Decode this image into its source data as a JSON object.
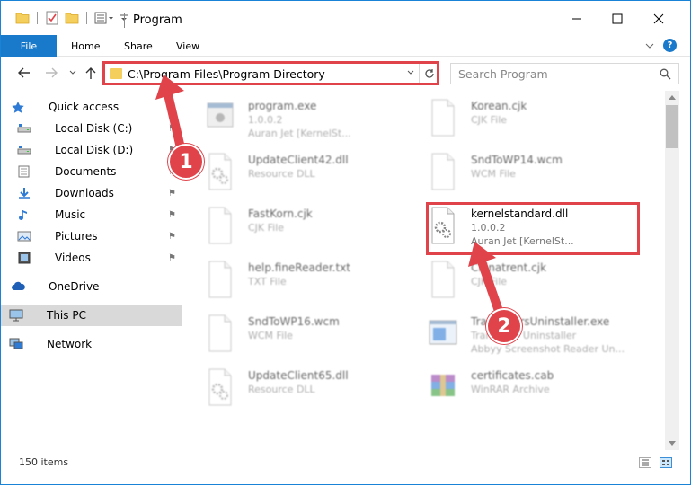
{
  "window": {
    "title": "Program",
    "minimize": "—",
    "maximize": "☐",
    "close": "✕"
  },
  "ribbon": {
    "tabs": [
      {
        "label": "File"
      },
      {
        "label": "Home"
      },
      {
        "label": "Share"
      },
      {
        "label": "View"
      }
    ],
    "help": "?"
  },
  "address": {
    "path": "C:\\Program Files\\Program Directory",
    "search_placeholder": "Search Program"
  },
  "nav": {
    "items": [
      {
        "label": "Quick access",
        "icon": "star-icon",
        "pinned": false
      },
      {
        "label": "Local Disk (C:)",
        "icon": "drive-icon",
        "pinned": true
      },
      {
        "label": "Local Disk (D:)",
        "icon": "drive-icon",
        "pinned": true
      },
      {
        "label": "Documents",
        "icon": "documents-icon",
        "pinned": true
      },
      {
        "label": "Downloads",
        "icon": "download-icon",
        "pinned": true
      },
      {
        "label": "Music",
        "icon": "music-icon",
        "pinned": true
      },
      {
        "label": "Pictures",
        "icon": "pictures-icon",
        "pinned": true
      },
      {
        "label": "Videos",
        "icon": "videos-icon",
        "pinned": true
      },
      {
        "label": "OneDrive",
        "icon": "cloud-icon",
        "pinned": false
      },
      {
        "label": "This PC",
        "icon": "computer-icon",
        "pinned": false
      },
      {
        "label": "Network",
        "icon": "network-icon",
        "pinned": false
      }
    ],
    "pin_glyph": "⚑"
  },
  "files": [
    {
      "name": "program.exe",
      "line2": "1.0.0.2",
      "line3": "Auran Jet [KernelSt...",
      "icon": "exe-icon"
    },
    {
      "name": "Korean.cjk",
      "line2": "CJK File",
      "line3": "",
      "icon": "file-icon"
    },
    {
      "name": "UpdateClient42.dll",
      "line2": "Resource DLL",
      "line3": "",
      "icon": "dll-icon"
    },
    {
      "name": "SndToWP14.wcm",
      "line2": "WCM File",
      "line3": "",
      "icon": "file-icon"
    },
    {
      "name": "FastKorn.cjk",
      "line2": "CJK File",
      "line3": "",
      "icon": "file-icon"
    },
    {
      "name": "kernelstandard.dll",
      "line2": "1.0.0.2",
      "line3": "Auran Jet [KernelSt...",
      "icon": "dll-icon"
    },
    {
      "name": "help.fineReader.txt",
      "line2": "TXT File",
      "line3": "",
      "icon": "file-icon"
    },
    {
      "name": "Chinatrent.cjk",
      "line2": "CJK File",
      "line3": "",
      "icon": "file-icon"
    },
    {
      "name": "SndToWP16.wcm",
      "line2": "WCM File",
      "line3": "",
      "icon": "file-icon"
    },
    {
      "name": "TranslatorsUninstaller.exe",
      "line2": "Translator Uninstaller",
      "line3": "Abbyy Screenshot Reader Un...",
      "icon": "installer-icon"
    },
    {
      "name": "UpdateClient65.dll",
      "line2": "Resource DLL",
      "line3": "",
      "icon": "dll-icon"
    },
    {
      "name": "certificates.cab",
      "line2": "WinRAR Archive",
      "line3": "",
      "icon": "archive-icon"
    }
  ],
  "status": {
    "count": "150 items"
  },
  "annotations": {
    "badge1": "1",
    "badge2": "2",
    "color": "#e0434a"
  }
}
